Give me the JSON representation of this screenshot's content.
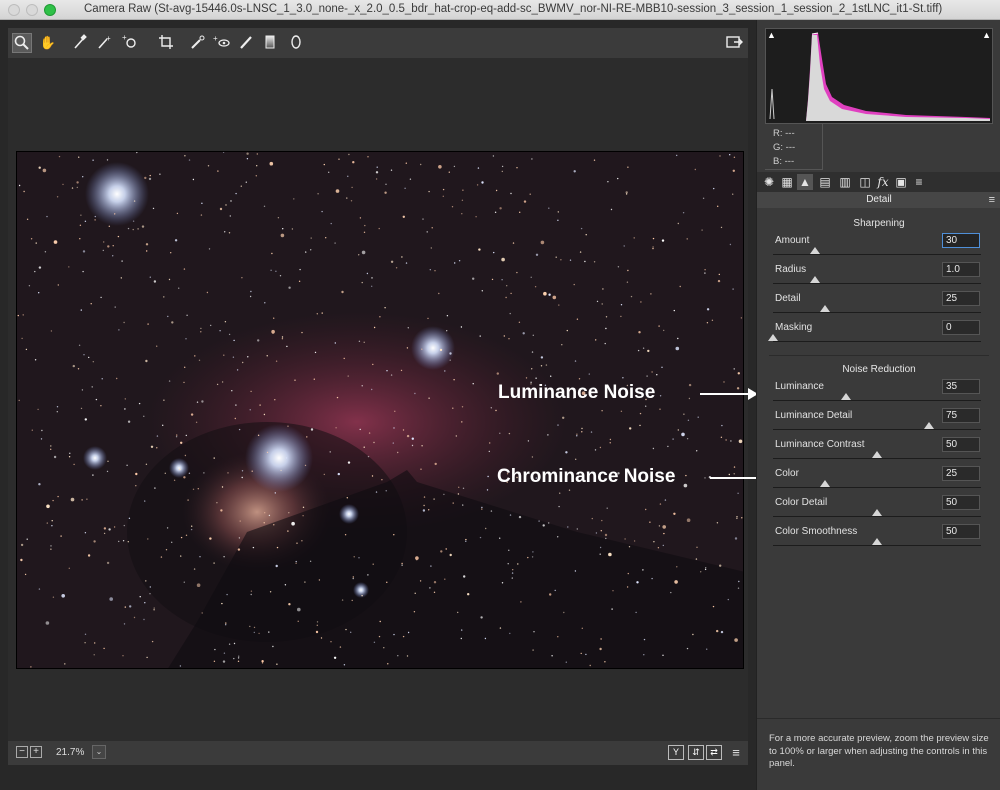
{
  "window": {
    "title": "Camera Raw (St-avg-15446.0s-LNSC_1_3.0_none-_x_2.0_0.5_bdr_hat-crop-eq-add-sc_BWMV_nor-NI-RE-MBB10-session_3_session_1_session_2_1stLNC_it1-St.tiff)"
  },
  "annotations": {
    "luminance": "Luminance Noise",
    "chrominance": "Chrominance Noise"
  },
  "bottom": {
    "zoom": "21.7%"
  },
  "rgb": {
    "r_label": "R:",
    "r_val": "---",
    "g_label": "G:",
    "g_val": "---",
    "b_label": "B:",
    "b_val": "---"
  },
  "panel": {
    "title": "Detail",
    "sharpening": {
      "title": "Sharpening",
      "amount": {
        "label": "Amount",
        "value": "30",
        "level": 0.2
      },
      "radius": {
        "label": "Radius",
        "value": "1.0",
        "level": 0.2
      },
      "detail": {
        "label": "Detail",
        "value": "25",
        "level": 0.25
      },
      "masking": {
        "label": "Masking",
        "value": "0",
        "level": 0.0
      }
    },
    "noise": {
      "title": "Noise Reduction",
      "luminance": {
        "label": "Luminance",
        "value": "35",
        "level": 0.35
      },
      "lum_detail": {
        "label": "Luminance Detail",
        "value": "75",
        "level": 0.75
      },
      "lum_contrast": {
        "label": "Luminance Contrast",
        "value": "50",
        "level": 0.5
      },
      "color": {
        "label": "Color",
        "value": "25",
        "level": 0.25
      },
      "color_detail": {
        "label": "Color Detail",
        "value": "50",
        "level": 0.5
      },
      "color_smooth": {
        "label": "Color Smoothness",
        "value": "50",
        "level": 0.5
      }
    },
    "help": "For a more accurate preview, zoom the preview size to 100% or larger when adjusting the controls in this panel."
  },
  "icons": {
    "tools": [
      "zoom-icon",
      "hand-icon",
      "white-balance-icon",
      "color-sampler-icon",
      "targeted-adjustment-icon",
      "crop-icon",
      "spot-removal-icon",
      "red-eye-icon",
      "brush-icon",
      "graduated-filter-icon",
      "radial-filter-icon"
    ],
    "tabs": [
      "basic-tab-icon",
      "tone-curve-tab-icon",
      "detail-tab-icon",
      "hsl-tab-icon",
      "split-toning-tab-icon",
      "lens-tab-icon",
      "effects-tab-icon",
      "calibration-tab-icon",
      "presets-tab-icon"
    ]
  },
  "colors": {
    "accent_focus": "#4f8fd8",
    "histogram_magenta": "#e040c0"
  }
}
